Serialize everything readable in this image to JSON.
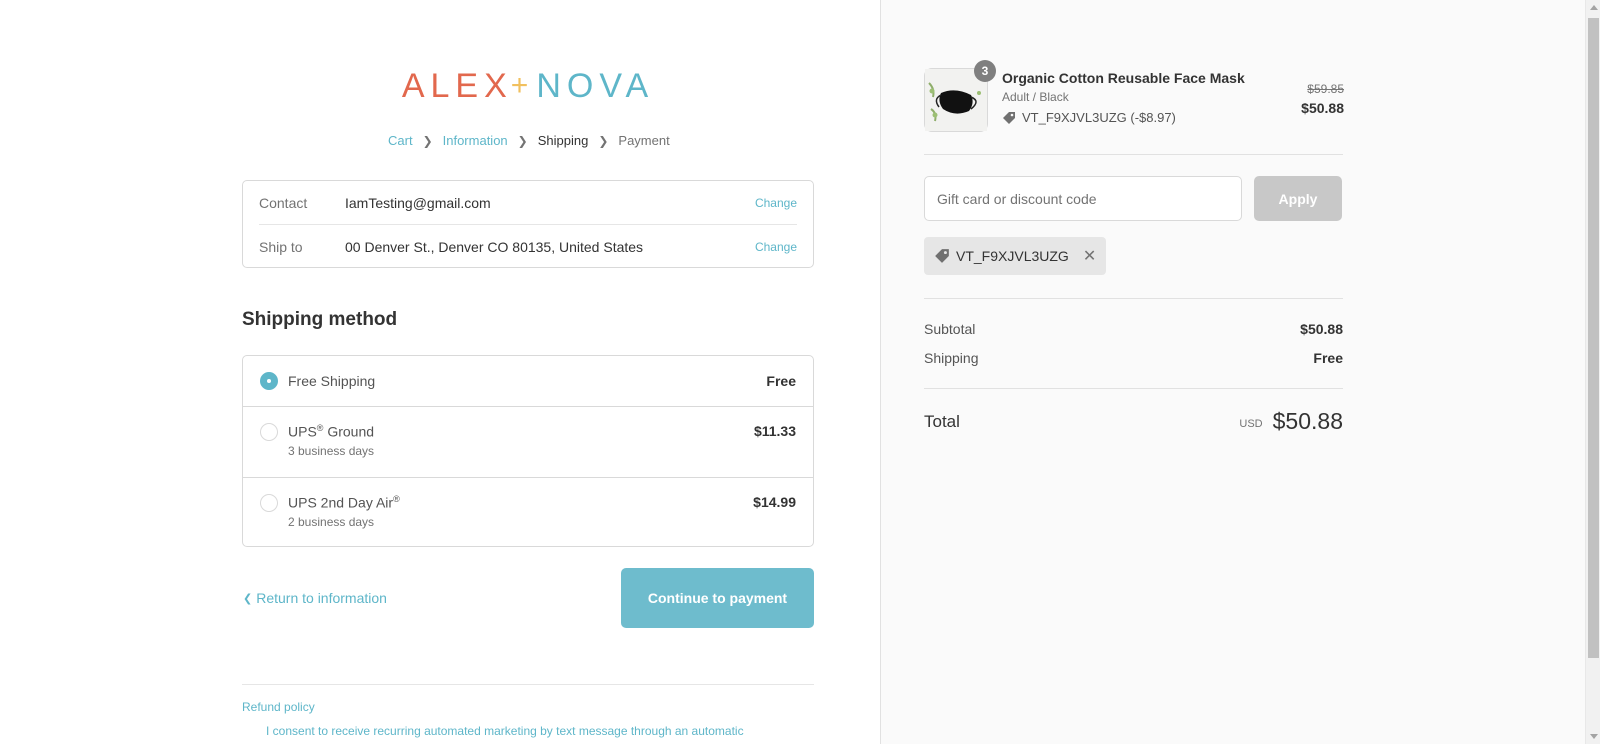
{
  "logo": {
    "part1": "ALEX",
    "plus": "+",
    "part2": "NOVA"
  },
  "breadcrumb": {
    "cart": "Cart",
    "information": "Information",
    "shipping": "Shipping",
    "payment": "Payment"
  },
  "review": {
    "contact_label": "Contact",
    "contact_value": "IamTesting@gmail.com",
    "ship_label": "Ship to",
    "ship_value": "00 Denver St., Denver CO 80135, United States",
    "change_label": "Change"
  },
  "shipping_method": {
    "title": "Shipping method",
    "options": [
      {
        "name": "Free Shipping",
        "sub": "",
        "price": "Free",
        "selected": true
      },
      {
        "name": "UPS",
        "sup": "®",
        "name_suffix": " Ground",
        "sub": "3 business days",
        "price": "$11.33",
        "selected": false
      },
      {
        "name": "UPS 2nd Day Air",
        "sup": "®",
        "sub": "2 business days",
        "price": "$14.99",
        "selected": false
      }
    ]
  },
  "nav": {
    "return_label": "Return to information",
    "continue_label": "Continue to payment"
  },
  "footer": {
    "refund": "Refund policy",
    "consent": "I consent to receive recurring automated marketing by text message through an automatic"
  },
  "cart": {
    "product": {
      "title": "Organic Cotton Reusable Face Mask",
      "variant": "Adult / Black",
      "discount": "VT_F9XJVL3UZG (-$8.97)",
      "quantity": "3",
      "price_old": "$59.85",
      "price_new": "$50.88"
    },
    "gift_placeholder": "Gift card or discount code",
    "apply_label": "Apply",
    "applied_code": "VT_F9XJVL3UZG",
    "subtotal_label": "Subtotal",
    "subtotal_value": "$50.88",
    "shipping_label": "Shipping",
    "shipping_value": "Free",
    "total_label": "Total",
    "currency": "USD",
    "total_value": "$50.88"
  },
  "colors": {
    "accent": "#5eb6c9",
    "logo_red": "#e2684d",
    "logo_yellow": "#f1c05e",
    "button": "#6ebccd"
  },
  "icons": [
    "chevron-right-icon",
    "chevron-left-icon",
    "tag-icon",
    "close-icon"
  ]
}
